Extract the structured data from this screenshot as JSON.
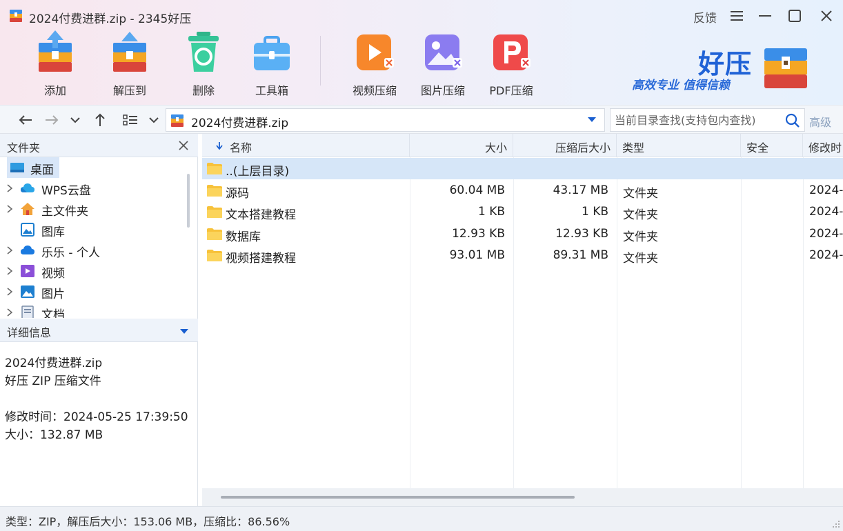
{
  "window": {
    "title": "2024付费进群.zip - 2345好压",
    "feedback_label": "反馈",
    "menu_icon": "hamburger-menu-icon",
    "minimize_icon": "minimize-icon",
    "maximize_icon": "maximize-icon",
    "close_icon": "close-icon"
  },
  "toolbar": {
    "items": [
      {
        "label": "添加",
        "icon": "add-archive-icon"
      },
      {
        "label": "解压到",
        "icon": "extract-to-icon"
      },
      {
        "label": "删除",
        "icon": "delete-recycle-icon"
      },
      {
        "label": "工具箱",
        "icon": "toolbox-icon"
      },
      {
        "label": "视频压缩",
        "icon": "video-compress-icon"
      },
      {
        "label": "图片压缩",
        "icon": "image-compress-icon"
      },
      {
        "label": "PDF压缩",
        "icon": "pdf-compress-icon"
      }
    ]
  },
  "brand": {
    "name": "好压",
    "slogan": "高效专业  值得信赖"
  },
  "address_bar": {
    "path": "2024付费进群.zip",
    "search_placeholder": "当前目录查找(支持包内查找)",
    "advanced_label": "高级"
  },
  "folders_panel": {
    "title": "文件夹",
    "items": [
      {
        "label": "桌面",
        "icon": "desktop-icon",
        "expandable": false,
        "selected": true
      },
      {
        "label": "WPS云盘",
        "icon": "wps-cloud-icon",
        "expandable": true
      },
      {
        "label": "主文件夹",
        "icon": "home-icon",
        "expandable": true
      },
      {
        "label": "图库",
        "icon": "gallery-icon",
        "expandable": false
      },
      {
        "label": "乐乐 - 个人",
        "icon": "onedrive-cloud-icon",
        "expandable": true
      },
      {
        "label": "视频",
        "icon": "video-folder-icon",
        "expandable": true
      },
      {
        "label": "图片",
        "icon": "pictures-folder-icon",
        "expandable": true
      },
      {
        "label": "文档",
        "icon": "documents-folder-icon",
        "expandable": true
      }
    ]
  },
  "details_panel": {
    "title": "详细信息",
    "file_name": "2024付费进群.zip",
    "file_type": "好压 ZIP 压缩文件",
    "modified": "修改时间：2024-05-25 17:39:50",
    "size": "大小：132.87 MB"
  },
  "file_list": {
    "columns": {
      "name": "名称",
      "size": "大小",
      "packed": "压缩后大小",
      "type": "类型",
      "security": "安全",
      "modified": "修改时"
    },
    "sort_indicator": "sort-down-arrow-icon",
    "rows": [
      {
        "name": "..(上层目录)",
        "size": "",
        "packed": "",
        "type": "",
        "security": "",
        "modified": "",
        "selected": true
      },
      {
        "name": "源码",
        "size": "60.04 MB",
        "packed": "43.17 MB",
        "type": "文件夹",
        "security": "",
        "modified": "2024-"
      },
      {
        "name": "文本搭建教程",
        "size": "1 KB",
        "packed": "1 KB",
        "type": "文件夹",
        "security": "",
        "modified": "2024-"
      },
      {
        "name": "数据库",
        "size": "12.93 KB",
        "packed": "12.93 KB",
        "type": "文件夹",
        "security": "",
        "modified": "2024-"
      },
      {
        "name": "视频搭建教程",
        "size": "93.01 MB",
        "packed": "89.31 MB",
        "type": "文件夹",
        "security": "",
        "modified": "2024-"
      }
    ]
  },
  "status_bar": {
    "text": "类型：ZIP，解压后大小：153.06 MB，压缩比：86.56%"
  },
  "colors": {
    "accent": "#1a5fd0",
    "selection": "#d6e6f8",
    "folder": "#f7c23b"
  }
}
